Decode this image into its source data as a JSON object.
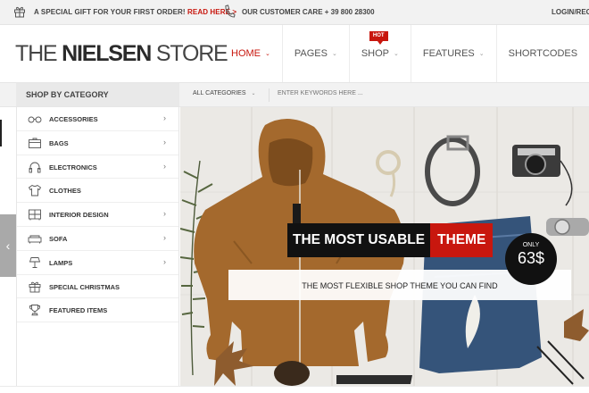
{
  "topbar": {
    "promo_text": "A SPECIAL GIFT FOR YOUR FIRST ORDER!",
    "promo_link": "READ HERE >",
    "care_text": "OUR CUSTOMER CARE + 39 800 28300",
    "login_text": "LOGIN/REG"
  },
  "header": {
    "logo_pre": "THE ",
    "logo_bold": "NIELSEN",
    "logo_post": " STORE",
    "nav": [
      {
        "label": "HOME",
        "active": true
      },
      {
        "label": "PAGES"
      },
      {
        "label": "SHOP",
        "badge": "HOT"
      },
      {
        "label": "FEATURES"
      },
      {
        "label": "SHORTCODES"
      }
    ]
  },
  "catbar": {
    "shop_by": "SHOP BY CATEGORY",
    "all_categories": "ALL CATEGORIES",
    "search_placeholder": "ENTER KEYWORDS HERE ..."
  },
  "categories": [
    {
      "label": "ACCESSORIES",
      "icon": "glasses-icon",
      "has_sub": true
    },
    {
      "label": "BAGS",
      "icon": "bag-icon",
      "has_sub": true
    },
    {
      "label": "ELECTRONICS",
      "icon": "headphones-icon",
      "has_sub": true
    },
    {
      "label": "CLOTHES",
      "icon": "tshirt-icon",
      "has_sub": false
    },
    {
      "label": "INTERIOR DESIGN",
      "icon": "cabinet-icon",
      "has_sub": true
    },
    {
      "label": "SOFA",
      "icon": "sofa-icon",
      "has_sub": true
    },
    {
      "label": "LAMPS",
      "icon": "lamp-icon",
      "has_sub": true
    },
    {
      "label": "SPECIAL CHRISTMAS",
      "icon": "gift-icon",
      "has_sub": false
    },
    {
      "label": "FEATURED ITEMS",
      "icon": "trophy-icon",
      "has_sub": false
    }
  ],
  "hero": {
    "title_part1": "THE MOST USABLE",
    "title_part2": "THEME",
    "subtitle": "THE MOST FLEXIBLE SHOP THEME YOU CAN FIND",
    "price_label": "ONLY",
    "price_value": "63$"
  },
  "colors": {
    "accent": "#c8170e",
    "dark": "#111111"
  }
}
